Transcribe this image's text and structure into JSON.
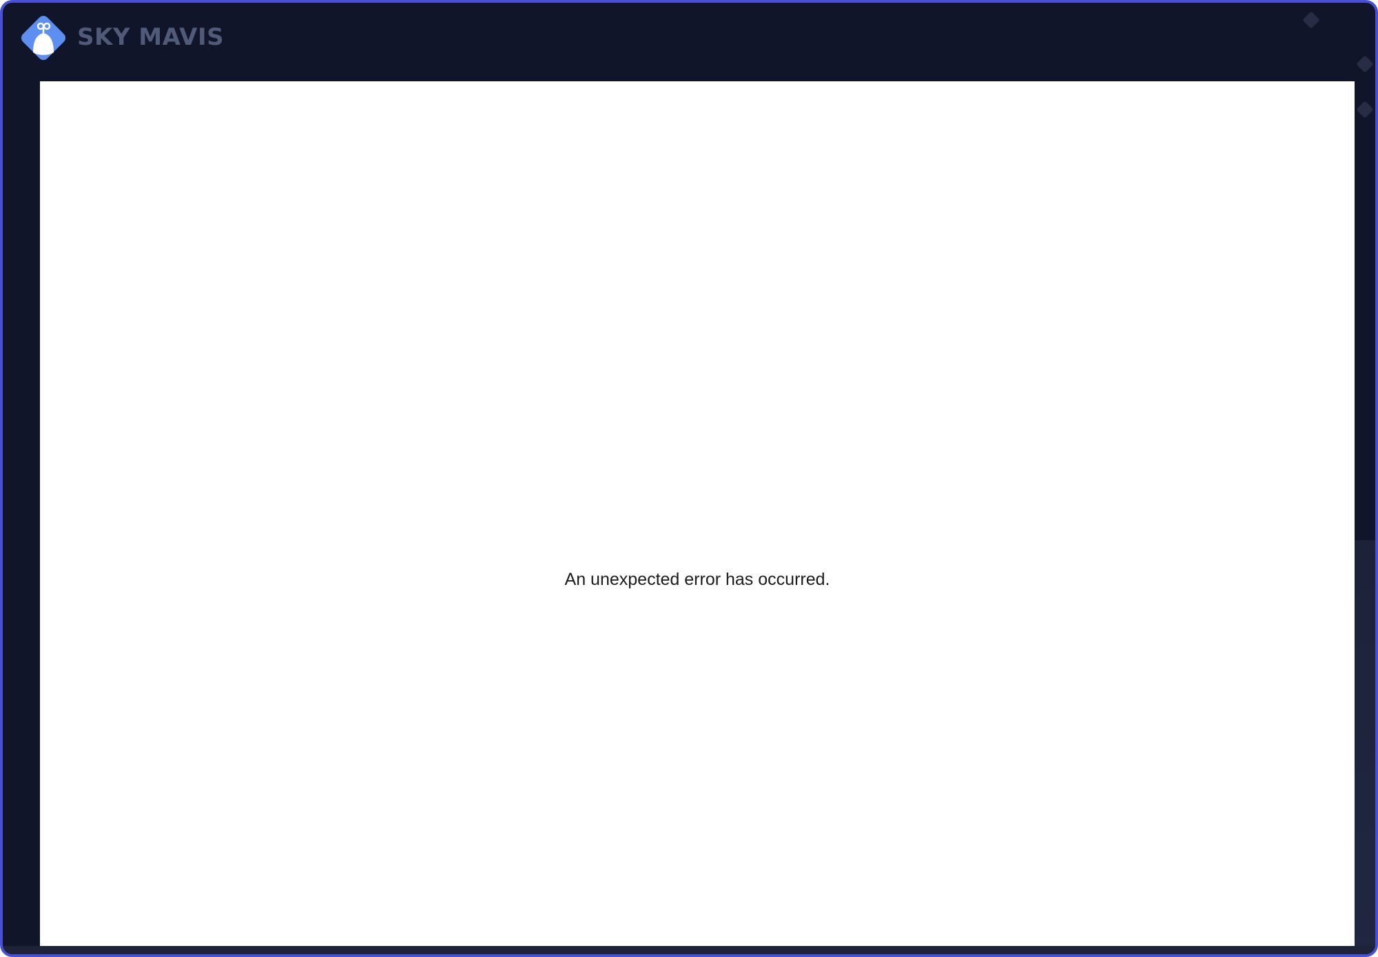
{
  "brand": {
    "name": "SKY MAVIS",
    "logo_icon": "sky-mavis-logo-icon"
  },
  "main": {
    "error_message": "An unexpected error has occurred."
  },
  "colors": {
    "frame_border": "#4651d8",
    "background": "#11152a",
    "logo_blue": "#5d8ff0",
    "brand_text": "#4f5b78"
  }
}
